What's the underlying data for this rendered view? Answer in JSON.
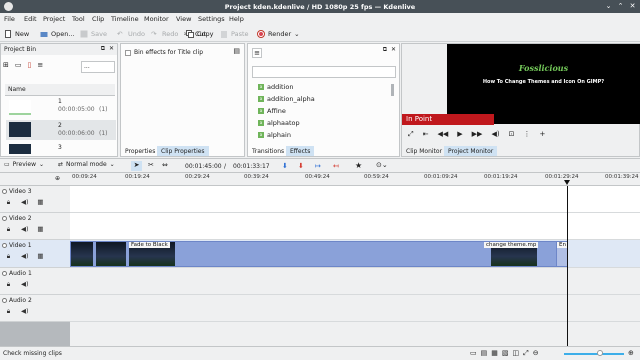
{
  "window": {
    "title": "Project kden.kdenlive / HD 1080p 25 fps — Kdenlive"
  },
  "menu": [
    "File",
    "Edit",
    "Project",
    "Tool",
    "Clip",
    "Timeline",
    "Monitor",
    "View",
    "Settings",
    "Help"
  ],
  "toolbar": {
    "new": "New",
    "open": "Open...",
    "save": "Save",
    "undo": "Undo",
    "redo": "Redo",
    "cut": "Cut",
    "copy": "Copy",
    "paste": "Paste",
    "render": "Render"
  },
  "project_bin": {
    "title": "Project Bin",
    "search_placeholder": "...",
    "column_name": "Name",
    "items": [
      {
        "num": "1",
        "duration": "00:00:05:00",
        "count": "(1)"
      },
      {
        "num": "2",
        "duration": "00:00:06:00",
        "count": "(1)"
      },
      {
        "num": "3",
        "duration": "",
        "count": ""
      }
    ]
  },
  "clip_properties": {
    "checkbox_label": "Bin effects for Title clip",
    "tabs": [
      "Properties",
      "Clip Properties"
    ]
  },
  "effects": {
    "items": [
      "addition",
      "addition_alpha",
      "Affine",
      "alphaatop",
      "alphain"
    ],
    "tabs": [
      "Transitions",
      "Effects"
    ]
  },
  "monitor": {
    "brand": "Fosslicious",
    "subtitle": "How To Change Themes and Icon On GIMP?",
    "in_point": "In Point",
    "tabs": [
      "Clip Monitor",
      "Project Monitor"
    ]
  },
  "timeline_toolbar": {
    "preview": "Preview",
    "mode": "Normal mode",
    "position": "00:01:45:00",
    "separator": "/",
    "duration": "00:01:33:17"
  },
  "ruler": {
    "ticks": [
      "00:09:24",
      "00:19:24",
      "00:29:24",
      "00:39:24",
      "00:49:24",
      "00:59:24",
      "00:01:09:24",
      "00:01:19:24",
      "00:01:29:24",
      "00:01:39:24"
    ]
  },
  "tracks": [
    {
      "name": "Video 3",
      "type": "video"
    },
    {
      "name": "Video 2",
      "type": "video"
    },
    {
      "name": "Video 1",
      "type": "video"
    },
    {
      "name": "Audio 1",
      "type": "audio"
    },
    {
      "name": "Audio 2",
      "type": "audio"
    }
  ],
  "clips": {
    "fade": "Fade to Black",
    "change_theme": "change theme.mp",
    "end": "En"
  },
  "status": {
    "text": "Check missing clips"
  }
}
